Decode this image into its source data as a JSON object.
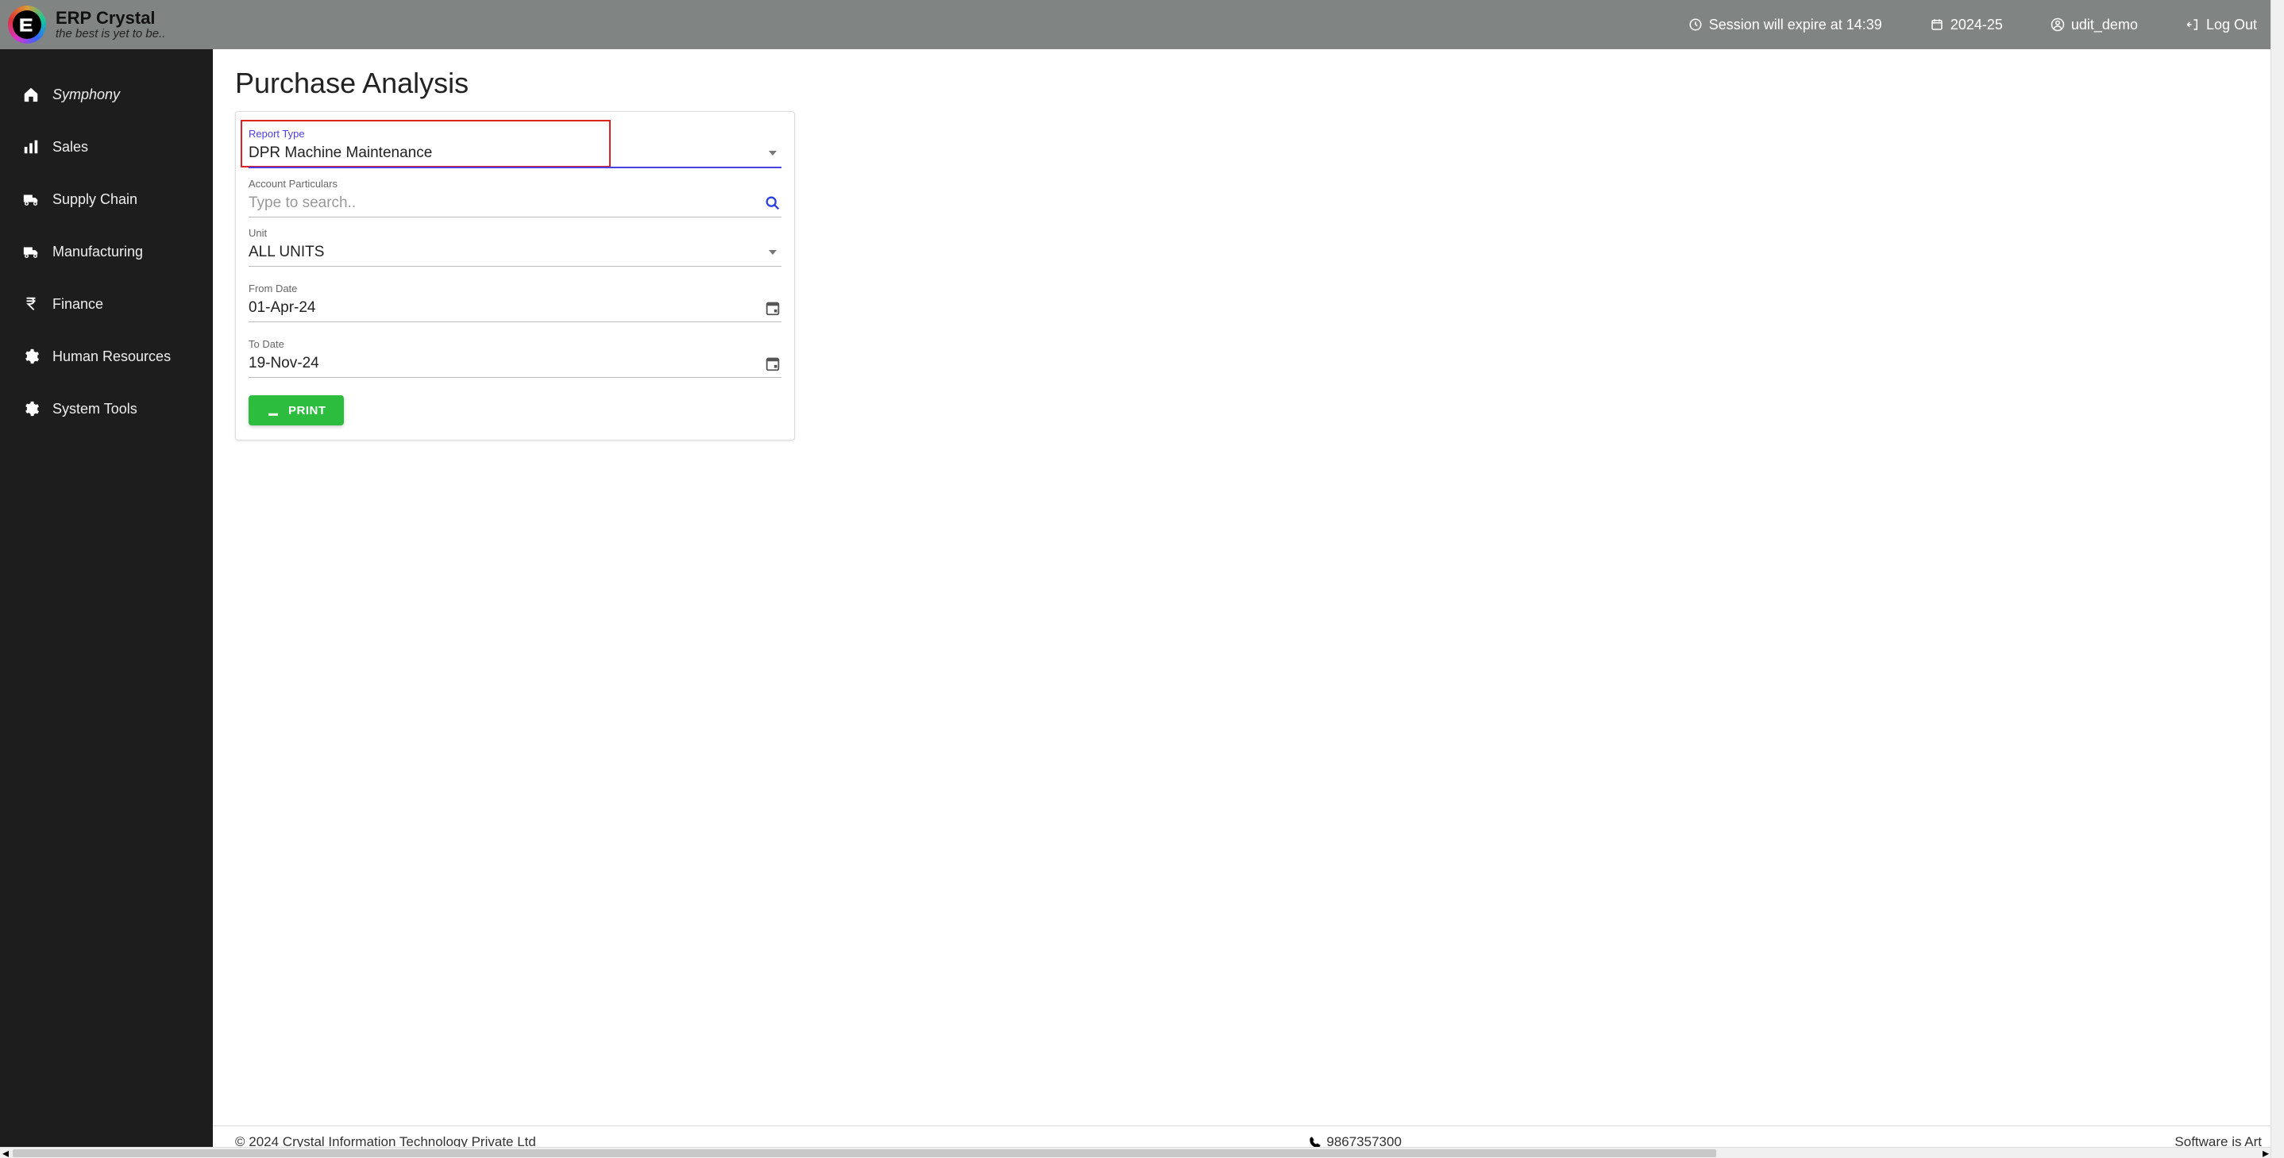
{
  "brand": {
    "title": "ERP Crystal",
    "tagline": "the best is yet to be.."
  },
  "header": {
    "session_text": "Session will expire at 14:39",
    "fy": "2024-25",
    "user": "udit_demo",
    "logout": "Log Out"
  },
  "sidebar": {
    "items": [
      {
        "label": "Symphony"
      },
      {
        "label": "Sales"
      },
      {
        "label": "Supply Chain"
      },
      {
        "label": "Manufacturing"
      },
      {
        "label": "Finance"
      },
      {
        "label": "Human Resources"
      },
      {
        "label": "System Tools"
      }
    ]
  },
  "page": {
    "title": "Purchase Analysis"
  },
  "form": {
    "report_type": {
      "label": "Report Type",
      "value": "DPR Machine Maintenance"
    },
    "account_particulars": {
      "label": "Account Particulars",
      "placeholder": "Type to search..",
      "value": ""
    },
    "unit": {
      "label": "Unit",
      "value": "ALL UNITS"
    },
    "from_date": {
      "label": "From Date",
      "value": "01-Apr-24"
    },
    "to_date": {
      "label": "To Date",
      "value": "19-Nov-24"
    },
    "print_label": "PRINT"
  },
  "footer": {
    "copyright": "© 2024 Crystal Information Technology Private Ltd",
    "phone": "9867357300",
    "motto": "Software is Art"
  }
}
